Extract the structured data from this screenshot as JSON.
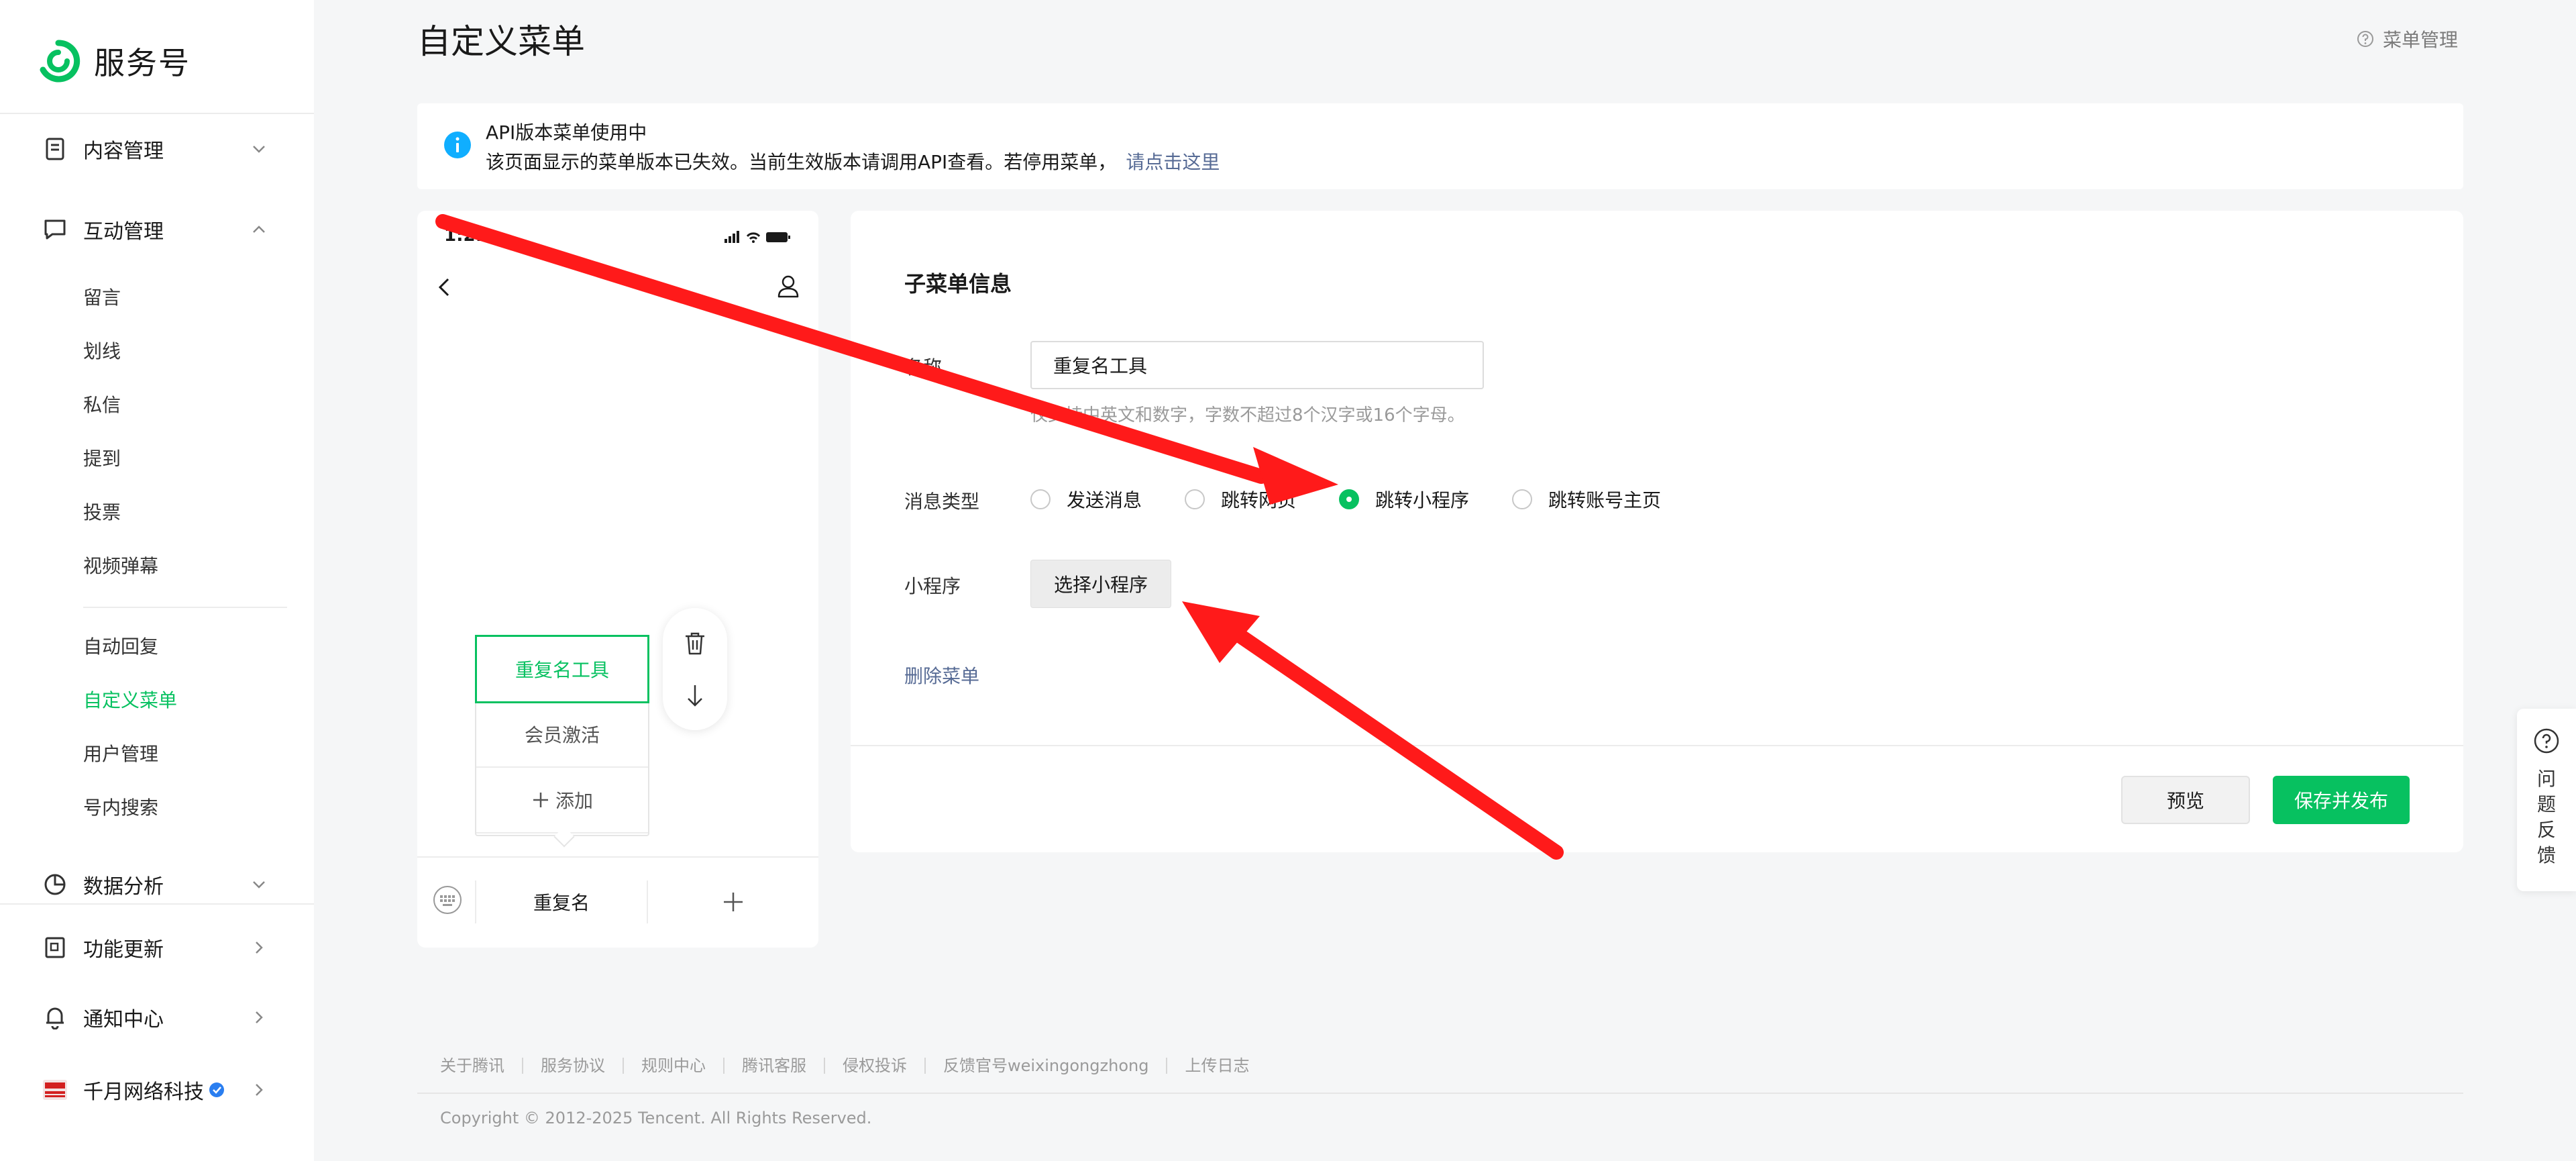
{
  "app": {
    "logo_text": "服务号"
  },
  "sidebar": {
    "sections": [
      {
        "label": "内容管理",
        "icon": "document-icon"
      },
      {
        "label": "互动管理",
        "icon": "chat-icon"
      },
      {
        "label": "数据分析",
        "icon": "pie-chart-icon"
      },
      {
        "label": "功能更新",
        "icon": "update-icon"
      },
      {
        "label": "通知中心",
        "icon": "bell-icon"
      }
    ],
    "interaction_items": [
      "留言",
      "划线",
      "私信",
      "提到",
      "投票",
      "视频弹幕"
    ],
    "interaction_items_2": [
      "自动回复",
      "自定义菜单",
      "用户管理",
      "号内搜索"
    ],
    "active_item": "自定义菜单",
    "account_name": "千月网络科技"
  },
  "header": {
    "title": "自定义菜单",
    "help_link": "菜单管理"
  },
  "notice": {
    "title": "API版本菜单使用中",
    "body": "该页面显示的菜单版本已失效。当前生效版本请调用API查看。若停用菜单，",
    "link": "请点击这里"
  },
  "phone": {
    "time": "1:21",
    "submenu_items": [
      "重复名工具",
      "会员激活"
    ],
    "add_label": "添加",
    "main_menu": "重复名"
  },
  "panel": {
    "title": "子菜单信息",
    "name_label": "名称",
    "name_value": "重复名工具",
    "name_hint": "仅支持中英文和数字，字数不超过8个汉字或16个字母。",
    "type_label": "消息类型",
    "types": [
      "发送消息",
      "跳转网页",
      "跳转小程序",
      "跳转账号主页"
    ],
    "selected_type": "跳转小程序",
    "miniprogram_label": "小程序",
    "pick_button": "选择小程序",
    "delete_link": "删除菜单",
    "preview_button": "预览",
    "publish_button": "保存并发布"
  },
  "feedback": {
    "chars": [
      "问",
      "题",
      "反",
      "馈"
    ]
  },
  "footer": {
    "links": [
      "关于腾讯",
      "服务协议",
      "规则中心",
      "腾讯客服",
      "侵权投诉",
      "反馈官号weixingongzhong",
      "上传日志"
    ],
    "copyright": "Copyright © 2012-2025 Tencent. All Rights Reserved."
  },
  "colors": {
    "brand_green": "#07c160",
    "link_blue": "#576b95",
    "info_blue": "#10aeff",
    "annotation_red": "#ff1a1a"
  }
}
